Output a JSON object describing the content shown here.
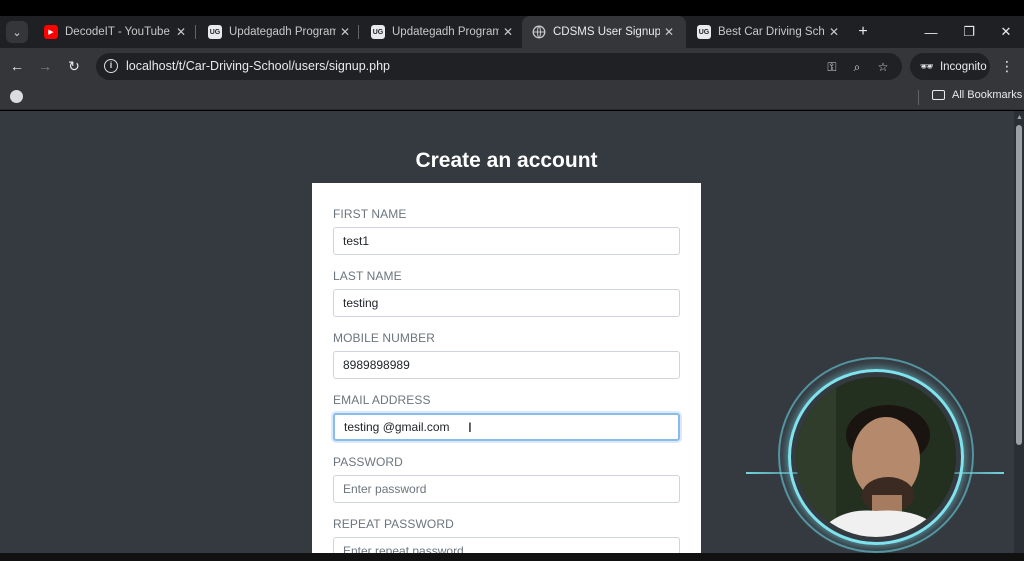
{
  "browser": {
    "tabs": [
      {
        "title": "DecodeIT - YouTube",
        "favicon": "youtube-icon",
        "active": false
      },
      {
        "title": "Updategadh Programmi",
        "favicon": "updategadh-icon",
        "active": false
      },
      {
        "title": "Updategadh Programmi",
        "favicon": "updategadh-icon",
        "active": false
      },
      {
        "title": "CDSMS User Signup",
        "favicon": "globe-icon",
        "active": true
      },
      {
        "title": "Best Car Driving School M",
        "favicon": "updategadh-icon",
        "active": false
      }
    ],
    "url": "localhost/t/Car-Driving-School/users/signup.php",
    "incognito_label": "Incognito",
    "bookmarks_label": "All Bookmarks"
  },
  "page": {
    "title": "Create an account",
    "fields": [
      {
        "label": "FIRST NAME",
        "value": "test1",
        "placeholder": ""
      },
      {
        "label": "LAST NAME",
        "value": "testing",
        "placeholder": ""
      },
      {
        "label": "MOBILE NUMBER",
        "value": "8989898989",
        "placeholder": ""
      },
      {
        "label": "EMAIL ADDRESS",
        "value": "testing @gmail.com",
        "placeholder": "",
        "focused": true
      },
      {
        "label": "PASSWORD",
        "value": "",
        "placeholder": "Enter password"
      },
      {
        "label": "REPEAT PASSWORD",
        "value": "",
        "placeholder": "Enter repeat password"
      }
    ]
  },
  "colors": {
    "page_bg": "#343a40",
    "card_bg": "#ffffff",
    "focus_ring": "#8bbce8"
  }
}
